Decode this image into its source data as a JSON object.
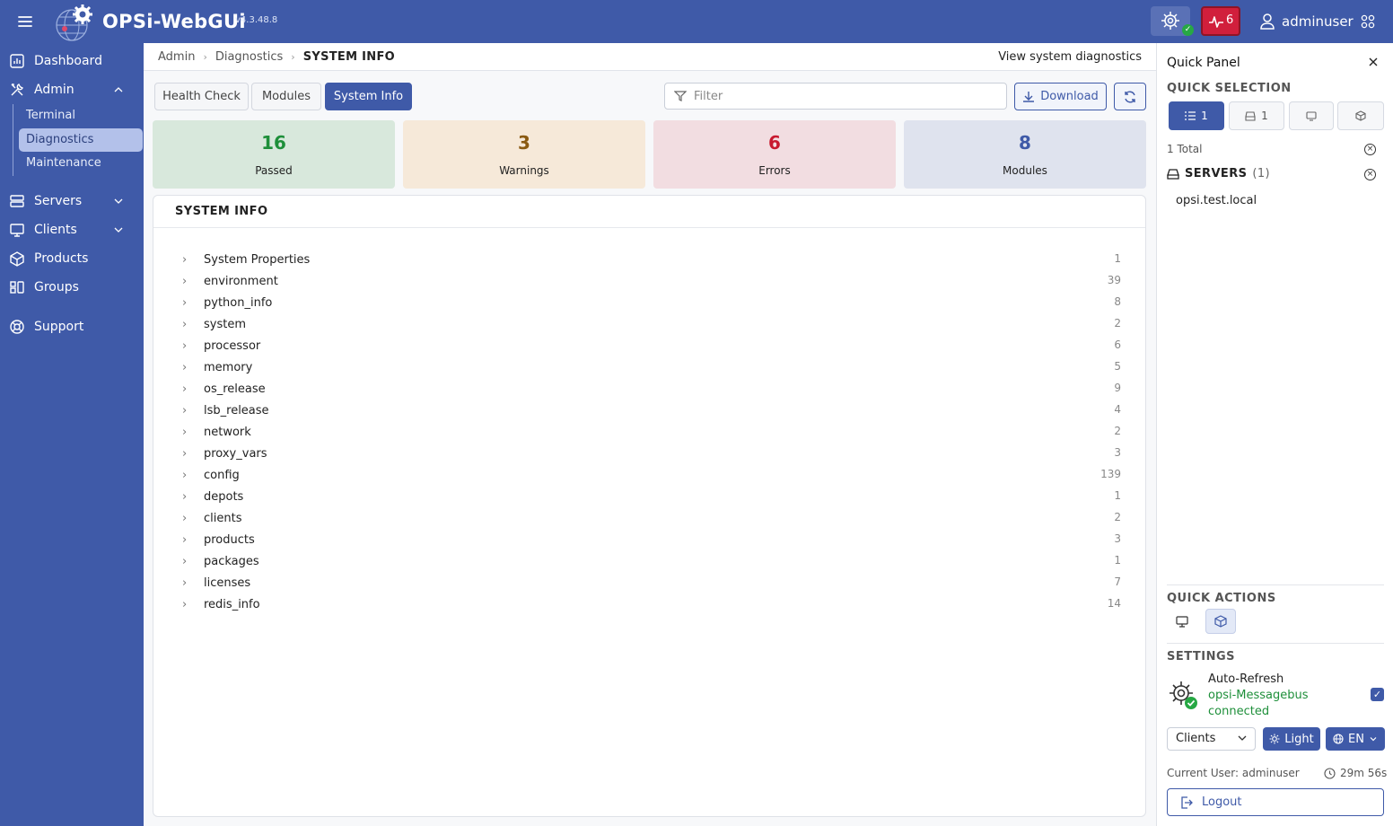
{
  "header": {
    "brand": "OPSi-WebGUi",
    "version": "v4.3.48.8",
    "alert_count": "6",
    "username": "adminuser"
  },
  "sidebar": {
    "items": [
      {
        "label": "Dashboard",
        "icon": "dashboard-icon"
      },
      {
        "label": "Admin",
        "icon": "tools-icon"
      },
      {
        "label": "Servers",
        "icon": "server-icon"
      },
      {
        "label": "Clients",
        "icon": "monitor-icon"
      },
      {
        "label": "Products",
        "icon": "box-icon"
      },
      {
        "label": "Groups",
        "icon": "groups-icon"
      },
      {
        "label": "Support",
        "icon": "lifebuoy-icon"
      }
    ],
    "admin_sub": [
      "Terminal",
      "Diagnostics",
      "Maintenance"
    ]
  },
  "breadcrumb": {
    "items": [
      "Admin",
      "Diagnostics",
      "SYSTEM INFO"
    ],
    "description": "View system diagnostics"
  },
  "tabs": [
    "Health Check",
    "Modules",
    "System Info"
  ],
  "filter": {
    "placeholder": "Filter"
  },
  "actions": {
    "download": "Download"
  },
  "stats": [
    {
      "value": "16",
      "label": "Passed"
    },
    {
      "value": "3",
      "label": "Warnings"
    },
    {
      "value": "6",
      "label": "Errors"
    },
    {
      "value": "8",
      "label": "Modules"
    }
  ],
  "panel": {
    "title": "SYSTEM INFO",
    "rows": [
      {
        "label": "System Properties",
        "count": "1"
      },
      {
        "label": "environment",
        "count": "39"
      },
      {
        "label": "python_info",
        "count": "8"
      },
      {
        "label": "system",
        "count": "2"
      },
      {
        "label": "processor",
        "count": "6"
      },
      {
        "label": "memory",
        "count": "5"
      },
      {
        "label": "os_release",
        "count": "9"
      },
      {
        "label": "lsb_release",
        "count": "4"
      },
      {
        "label": "network",
        "count": "2"
      },
      {
        "label": "proxy_vars",
        "count": "3"
      },
      {
        "label": "config",
        "count": "139"
      },
      {
        "label": "depots",
        "count": "1"
      },
      {
        "label": "clients",
        "count": "2"
      },
      {
        "label": "products",
        "count": "3"
      },
      {
        "label": "packages",
        "count": "1"
      },
      {
        "label": "licenses",
        "count": "7"
      },
      {
        "label": "redis_info",
        "count": "14"
      }
    ]
  },
  "quick_panel": {
    "title": "Quick Panel",
    "quick_selection": "QUICK SELECTION",
    "selection_counts": [
      "1",
      "1"
    ],
    "total": "1 Total",
    "servers_label": "SERVERS",
    "servers_count": "(1)",
    "server_entry": "opsi.test.local",
    "quick_actions": "QUICK ACTIONS",
    "settings": "SETTINGS",
    "auto_refresh": "Auto-Refresh",
    "messagebus": "opsi-Messagebus",
    "messagebus_status": "connected",
    "select_value": "Clients",
    "theme": "Light",
    "language": "EN",
    "current_user": "Current User: adminuser",
    "timer": "29m 56s",
    "logout": "Logout"
  },
  "colors": {
    "brand": "#3f5aa8",
    "passed": "#1e8f3a",
    "warnings": "#8a5a12",
    "errors": "#c8192f",
    "modules": "#3f5aa8"
  }
}
